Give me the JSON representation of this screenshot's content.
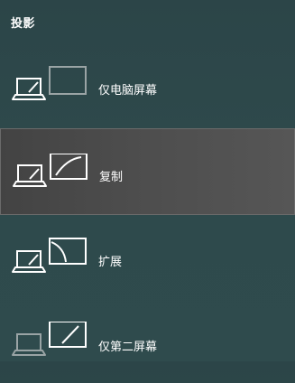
{
  "flyout": {
    "title": "投影"
  },
  "options": [
    {
      "label": "仅电脑屏幕",
      "icon": "pc-screen-only-icon",
      "selected": false
    },
    {
      "label": "复制",
      "icon": "duplicate-icon",
      "selected": true
    },
    {
      "label": "扩展",
      "icon": "extend-icon",
      "selected": false
    },
    {
      "label": "仅第二屏幕",
      "icon": "second-screen-only-icon",
      "selected": false
    }
  ],
  "colors": {
    "background": "#2e4a4c",
    "selected_background": "#4d4d4d",
    "active_icon": "#ffffff",
    "inactive_icon": "#9aa4a5"
  }
}
